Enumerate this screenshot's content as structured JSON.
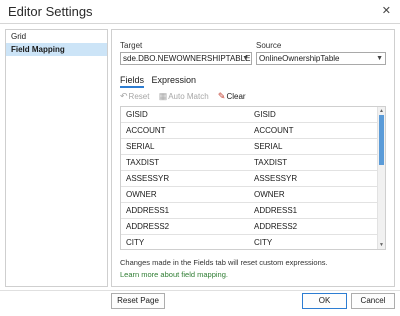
{
  "window": {
    "title": "Editor Settings",
    "close_glyph": "✕"
  },
  "sidebar": {
    "items": [
      {
        "label": "Grid"
      },
      {
        "label": "Field Mapping"
      }
    ]
  },
  "target": {
    "label": "Target",
    "value": "sde.DBO.NEWOWNERSHIPTABLE"
  },
  "source": {
    "label": "Source",
    "value": "OnlineOwnershipTable"
  },
  "tabs": [
    {
      "label": "Fields"
    },
    {
      "label": "Expression"
    }
  ],
  "toolbar": {
    "reset": "Reset",
    "auto_match": "Auto Match",
    "clear": "Clear"
  },
  "grid": {
    "rows": [
      [
        "GISID",
        "GISID"
      ],
      [
        "ACCOUNT",
        "ACCOUNT"
      ],
      [
        "SERIAL",
        "SERIAL"
      ],
      [
        "TAXDIST",
        "TAXDIST"
      ],
      [
        "ASSESSYR",
        "ASSESSYR"
      ],
      [
        "OWNER",
        "OWNER"
      ],
      [
        "ADDRESS1",
        "ADDRESS1"
      ],
      [
        "ADDRESS2",
        "ADDRESS2"
      ],
      [
        "CITY",
        "CITY"
      ]
    ]
  },
  "note": "Changes made in the Fields tab will reset custom expressions.",
  "learn_more": "Learn more about field mapping.",
  "buttons": {
    "reset_page": "Reset Page",
    "ok": "OK",
    "cancel": "Cancel"
  },
  "colors": {
    "accent": "#2d7dd2",
    "selection": "#cce4f7",
    "link": "#2e7d32"
  }
}
